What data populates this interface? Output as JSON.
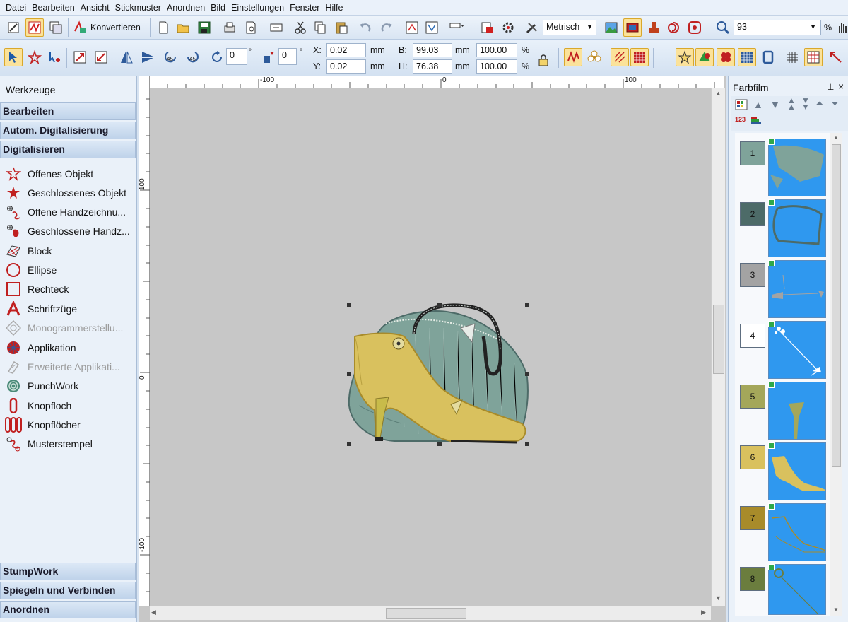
{
  "menu": [
    "Datei",
    "Bearbeiten",
    "Ansicht",
    "Stickmuster",
    "Anordnen",
    "Bild",
    "Einstellungen",
    "Fenster",
    "Hilfe"
  ],
  "toolbar": {
    "konvertieren_label": "Konvertieren",
    "unit_select": "Metrisch",
    "zoom_value": "93",
    "zoom_unit": "%"
  },
  "transform": {
    "rotate_value": "0",
    "rotate_unit": "°",
    "slant_value": "0",
    "slant_unit": "°",
    "x_label": "X:",
    "x_value": "0.02",
    "x_unit": "mm",
    "y_label": "Y:",
    "y_value": "0.02",
    "y_unit": "mm",
    "b_label": "B:",
    "b_value": "99.03",
    "b_unit": "mm",
    "b_pct": "100.00",
    "b_pct_unit": "%",
    "h_label": "H:",
    "h_value": "76.38",
    "h_unit": "mm",
    "h_pct": "100.00",
    "h_pct_unit": "%"
  },
  "left_panel": {
    "title": "Werkzeuge",
    "sections_top": [
      "Bearbeiten",
      "Autom. Digitalisierung",
      "Digitalisieren"
    ],
    "tools": [
      {
        "label": "Offenes Objekt",
        "icon": "open-object-icon",
        "enabled": true
      },
      {
        "label": "Geschlossenes Objekt",
        "icon": "closed-object-icon",
        "enabled": true
      },
      {
        "label": "Offene Handzeichnu...",
        "icon": "open-freehand-icon",
        "enabled": true
      },
      {
        "label": "Geschlossene Handz...",
        "icon": "closed-freehand-icon",
        "enabled": true
      },
      {
        "label": "Block",
        "icon": "block-icon",
        "enabled": true
      },
      {
        "label": "Ellipse",
        "icon": "ellipse-icon",
        "enabled": true
      },
      {
        "label": "Rechteck",
        "icon": "rectangle-icon",
        "enabled": true
      },
      {
        "label": "Schriftzüge",
        "icon": "lettering-icon",
        "enabled": true
      },
      {
        "label": "Monogrammerstellu...",
        "icon": "monogram-icon",
        "enabled": false
      },
      {
        "label": "Applikation",
        "icon": "applique-icon",
        "enabled": true
      },
      {
        "label": "Erweiterte Applikati...",
        "icon": "advanced-applique-icon",
        "enabled": false
      },
      {
        "label": "PunchWork",
        "icon": "punchwork-icon",
        "enabled": true
      },
      {
        "label": "Knopfloch",
        "icon": "buttonhole-icon",
        "enabled": true
      },
      {
        "label": "Knopflöcher",
        "icon": "buttonholes-icon",
        "enabled": true
      },
      {
        "label": "Musterstempel",
        "icon": "pattern-stamp-icon",
        "enabled": true
      }
    ],
    "sections_bottom": [
      "StumpWork",
      "Spiegeln und Verbinden",
      "Anordnen"
    ]
  },
  "rulers": {
    "h_ticks": [
      "-100",
      "0",
      "100"
    ],
    "v_ticks": [
      "100",
      "0",
      "-100"
    ]
  },
  "right_panel": {
    "title": "Farbfilm",
    "colors": [
      {
        "num": "1",
        "color": "#7fa39a"
      },
      {
        "num": "2",
        "color": "#4d6b68"
      },
      {
        "num": "3",
        "color": "#a3a3a3"
      },
      {
        "num": "4",
        "color": "#ffffff"
      },
      {
        "num": "5",
        "color": "#a4a75a"
      },
      {
        "num": "6",
        "color": "#d9c15e"
      },
      {
        "num": "7",
        "color": "#a88b2a"
      },
      {
        "num": "8",
        "color": "#6b7d3e"
      }
    ]
  }
}
